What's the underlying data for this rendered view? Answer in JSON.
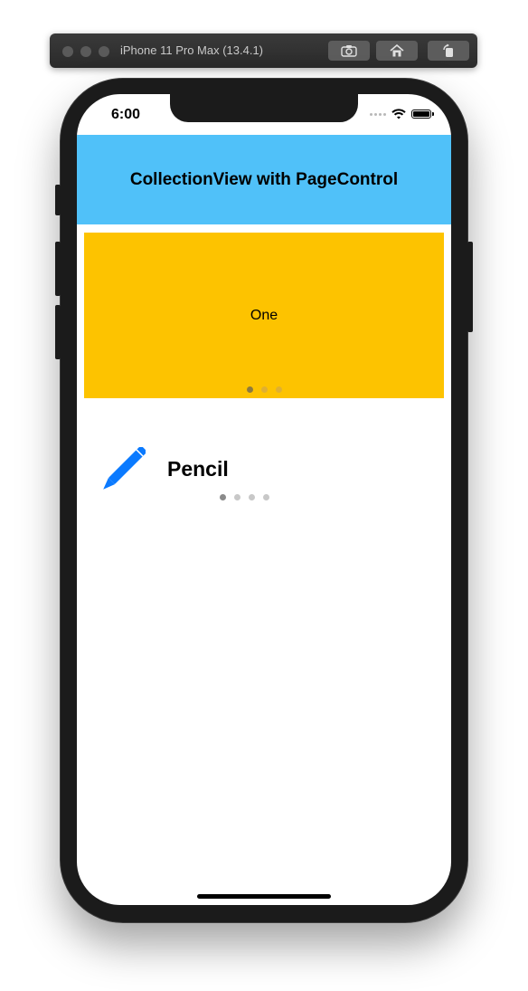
{
  "simulator": {
    "window_title": "iPhone 11 Pro Max (13.4.1)",
    "toolbar_buttons": [
      {
        "icon": "screenshot-icon"
      },
      {
        "icon": "home-icon"
      },
      {
        "icon": "rotate-icon"
      }
    ]
  },
  "status_bar": {
    "time": "6:00"
  },
  "nav": {
    "title": "CollectionView with PageControl",
    "background": "#50c1f9"
  },
  "carousel": {
    "label": "One",
    "background": "#fdc300",
    "page_count": 3,
    "current_page": 1
  },
  "item": {
    "icon": "pencil-icon",
    "icon_color": "#0a7aff",
    "label": "Pencil",
    "page_count": 4,
    "current_page": 1
  }
}
